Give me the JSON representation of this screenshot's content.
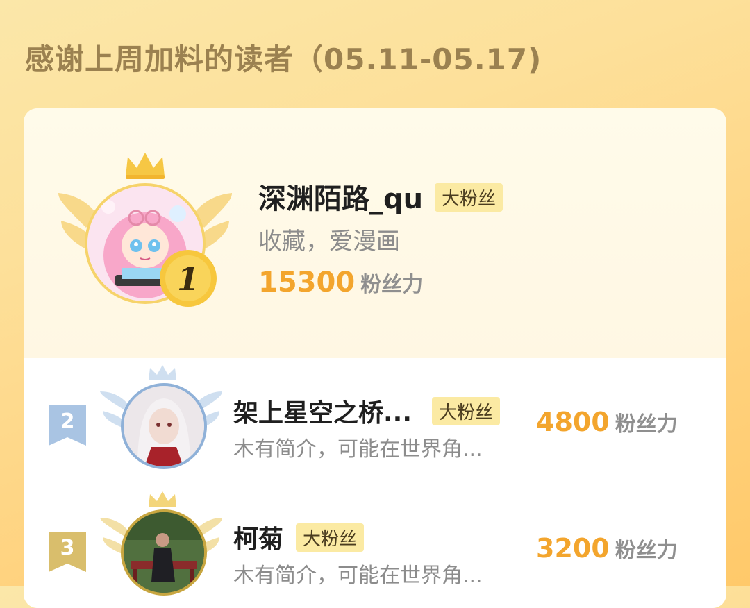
{
  "header": {
    "title": "感谢上周加料的读者（05.11-05.17)"
  },
  "top_reader": {
    "rank": "1",
    "name": "深渊陌路_qu",
    "badge": "大粉丝",
    "bio": "收藏，爱漫画",
    "score": "15300",
    "score_unit": "粉丝力"
  },
  "readers": [
    {
      "rank": "2",
      "name": "架上星空之桥...",
      "badge": "大粉丝",
      "bio": "木有简介，可能在世界角...",
      "score": "4800",
      "score_unit": "粉丝力"
    },
    {
      "rank": "3",
      "name": "柯菊",
      "badge": "大粉丝",
      "bio": "木有简介，可能在世界角...",
      "score": "3200",
      "score_unit": "粉丝力"
    }
  ],
  "colors": {
    "accent_score": "#f3a52d",
    "badge_bg": "#fbeaa3",
    "title": "#9b8150",
    "gold": "#f6c744",
    "silver": "#a9c4e3",
    "bronze": "#d9be6c"
  }
}
